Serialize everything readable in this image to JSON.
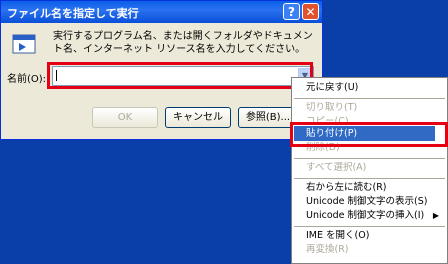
{
  "dialog": {
    "title": "ファイル名を指定して実行",
    "help_glyph": "?",
    "close_glyph": "✕",
    "description": "実行するプログラム名、または開くフォルダやドキュメント名、インターネット リソース名を入力してください。",
    "name_label": "名前(O):",
    "name_value": "",
    "ok_label": "OK",
    "cancel_label": "キャンセル",
    "browse_label": "参照(B)..."
  },
  "context_menu": {
    "items": [
      {
        "label": "元に戻す(U)",
        "enabled": true
      },
      {
        "label": "切り取り(T)",
        "enabled": false
      },
      {
        "label": "コピー(C)",
        "enabled": false
      },
      {
        "label": "貼り付け(P)",
        "enabled": true,
        "selected": true
      },
      {
        "label": "削除(D)",
        "enabled": false
      },
      {
        "label": "すべて選択(A)",
        "enabled": false
      },
      {
        "label": "右から左に読む(R)",
        "enabled": true
      },
      {
        "label": "Unicode 制御文字の表示(S)",
        "enabled": true
      },
      {
        "label": "Unicode 制御文字の挿入(I)",
        "enabled": true
      },
      {
        "label": "IME を開く(O)",
        "enabled": true
      },
      {
        "label": "再変換(R)",
        "enabled": false
      }
    ],
    "submenu_arrow": "▶"
  },
  "colors": {
    "desktop": "#0a3ea8",
    "highlight_box": "#e50014",
    "menu_selection": "#316ac5"
  }
}
